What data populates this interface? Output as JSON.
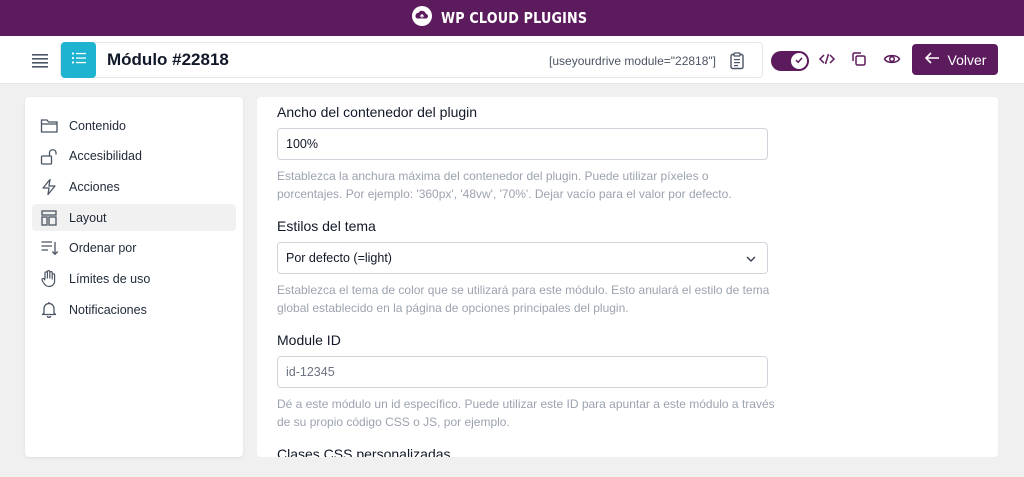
{
  "brand": {
    "name": "WP CLOUD PLUGINS"
  },
  "toolbar": {
    "title": "Módulo #22818",
    "shortcode": "[useyourdrive module=\"22818\"]",
    "back_label": "Volver"
  },
  "colors": {
    "brand": "#5c1b5c",
    "accent": "#1fb3d2"
  },
  "sidebar": {
    "items": [
      {
        "label": "Contenido",
        "icon": "folder-icon"
      },
      {
        "label": "Accesibilidad",
        "icon": "unlock-icon"
      },
      {
        "label": "Acciones",
        "icon": "lightning-icon"
      },
      {
        "label": "Layout",
        "icon": "layout-icon",
        "active": true
      },
      {
        "label": "Ordenar por",
        "icon": "sort-icon"
      },
      {
        "label": "Límites de uso",
        "icon": "hand-icon"
      },
      {
        "label": "Notificaciones",
        "icon": "bell-icon"
      }
    ]
  },
  "form": {
    "width": {
      "label": "Ancho del contenedor del plugin",
      "value": "100%",
      "help": "Establezca la anchura máxima del contenedor del plugin. Puede utilizar píxeles o porcentajes. Por ejemplo: '360px', '48vw', '70%'. Dejar vacío para el valor por defecto."
    },
    "theme": {
      "label": "Estilos del tema",
      "value": "Por defecto (=light)",
      "help": "Establezca el tema de color que se utilizará para este módulo. Esto anulará el estilo de tema global establecido en la página de opciones principales del plugin."
    },
    "module_id": {
      "label": "Module ID",
      "placeholder": "id-12345",
      "help": "Dé a este módulo un id específico. Puede utilizar este ID para apuntar a este módulo a través de su propio código CSS o JS, por ejemplo."
    },
    "css_classes": {
      "label": "Clases CSS personalizadas"
    }
  }
}
